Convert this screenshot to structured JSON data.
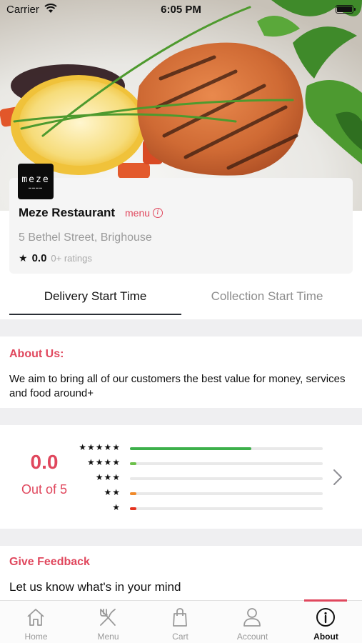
{
  "status_bar": {
    "carrier": "Carrier",
    "time": "6:05 PM"
  },
  "restaurant": {
    "logo_text": "meze",
    "name": "Meze Restaurant",
    "menu_link": "menu",
    "address": "5 Bethel Street, Brighouse",
    "rating": "0.0",
    "rating_count": "0+ ratings"
  },
  "tabs": [
    {
      "label": "Delivery Start Time",
      "active": true
    },
    {
      "label": "Collection Start Time",
      "active": false
    }
  ],
  "about": {
    "title": "About Us:",
    "text": "We aim to bring all of our customers the best value for money, services and food around+"
  },
  "ratings_summary": {
    "score": "0.0",
    "score_label": "Out of 5",
    "bars": [
      {
        "stars": "★★★★★",
        "fraction": 0.63,
        "color": "#3db04b"
      },
      {
        "stars": "★★★★",
        "fraction": 0.035,
        "color": "#6cc04a"
      },
      {
        "stars": "★★★",
        "fraction": 0.0,
        "color": "#c9c9c9"
      },
      {
        "stars": "★★",
        "fraction": 0.035,
        "color": "#f08a2a"
      },
      {
        "stars": "★",
        "fraction": 0.035,
        "color": "#e4331f"
      }
    ]
  },
  "feedback": {
    "title": "Give Feedback",
    "text": "Let us know what's in your mind"
  },
  "bottom_nav": [
    {
      "label": "Home",
      "icon": "home-icon",
      "active": false
    },
    {
      "label": "Menu",
      "icon": "fork-knife-icon",
      "active": false
    },
    {
      "label": "Cart",
      "icon": "shopping-bag-icon",
      "active": false
    },
    {
      "label": "Account",
      "icon": "user-icon",
      "active": false
    },
    {
      "label": "About",
      "icon": "info-icon",
      "active": true
    }
  ],
  "colors": {
    "accent": "#e0475d",
    "tab_underline": "#2b2f36"
  }
}
